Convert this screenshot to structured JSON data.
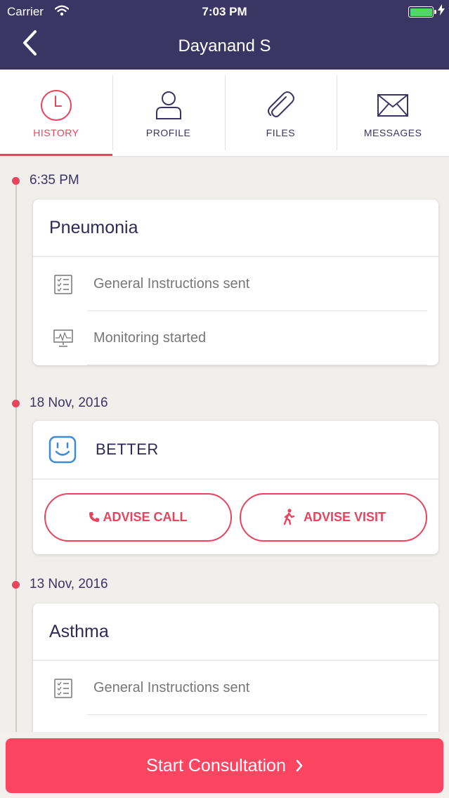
{
  "status_bar": {
    "carrier": "Carrier",
    "time": "7:03 PM"
  },
  "nav": {
    "title": "Dayanand S"
  },
  "tabs": [
    {
      "label": "HISTORY",
      "icon": "clock-icon",
      "active": true
    },
    {
      "label": "PROFILE",
      "icon": "person-icon",
      "active": false
    },
    {
      "label": "FILES",
      "icon": "paperclip-icon",
      "active": false
    },
    {
      "label": "MESSAGES",
      "icon": "envelope-icon",
      "active": false
    }
  ],
  "timeline": [
    {
      "date": "6:35 PM",
      "title": "Pneumonia",
      "rows": [
        {
          "icon": "checklist-icon",
          "text": "General Instructions sent"
        },
        {
          "icon": "monitor-icon",
          "text": "Monitoring started"
        }
      ]
    },
    {
      "date": "18 Nov, 2016",
      "mood": {
        "icon": "smiley-icon",
        "text": "BETTER"
      },
      "actions": [
        {
          "icon": "phone-icon",
          "label": "ADVISE CALL"
        },
        {
          "icon": "walking-person-icon",
          "label": "ADVISE VISIT"
        }
      ]
    },
    {
      "date": "13 Nov, 2016",
      "title": "Asthma",
      "rows": [
        {
          "icon": "checklist-icon",
          "text": "General Instructions sent"
        }
      ]
    }
  ],
  "cta": {
    "label": "Start Consultation"
  },
  "colors": {
    "header": "#3b3564",
    "accent": "#e8445d",
    "cta": "#fc4560",
    "text_dark": "#2e2a55",
    "battery": "#4cd964"
  }
}
